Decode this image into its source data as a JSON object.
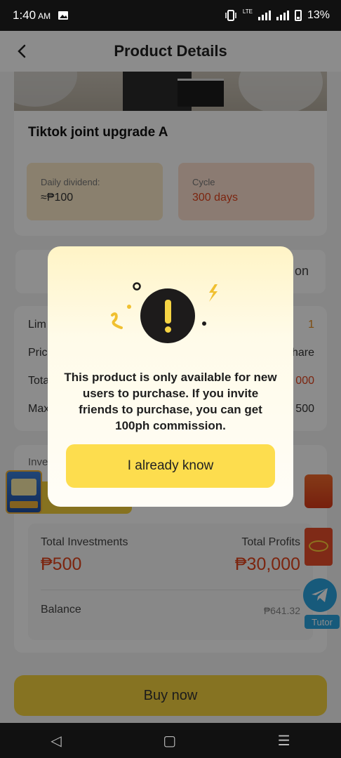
{
  "status_bar": {
    "time": "1:40",
    "ampm": "AM",
    "network": "LTE",
    "battery": "13%"
  },
  "header": {
    "title": "Product Details"
  },
  "product": {
    "name": "Tiktok joint upgrade A",
    "daily_dividend_label": "Daily dividend:",
    "daily_dividend_value": "≈₱100",
    "cycle_label": "Cycle",
    "cycle_value": "300 days"
  },
  "tabs": {
    "right_fragment": "on"
  },
  "details": {
    "rows": [
      {
        "label": "Lim",
        "value": "1"
      },
      {
        "label": "Pric",
        "value": "hare"
      },
      {
        "label": "Tota",
        "value": "000"
      },
      {
        "label": "Max",
        "value": "500"
      }
    ]
  },
  "investment": {
    "label": "Inve",
    "total_investments_label": "Total Investments",
    "total_investments_value": "₱500",
    "total_profits_label": "Total Profits",
    "total_profits_value": "₱30,000",
    "balance_label": "Balance",
    "balance_value": "₱641.32"
  },
  "floating": {
    "tutor_label": "Tutor"
  },
  "buy_button": {
    "label": "Buy now"
  },
  "navbar": {
    "back": "◁",
    "home": "▢",
    "menu": "☰"
  },
  "modal": {
    "message": "This product is only available for new users to purchase. If you invite friends to purchase, you can get 100ph commission.",
    "button_label": "I already know"
  },
  "colors": {
    "accent_yellow": "#f5d13f",
    "price_red": "#e2441d",
    "modal_button": "#fddd4e"
  }
}
